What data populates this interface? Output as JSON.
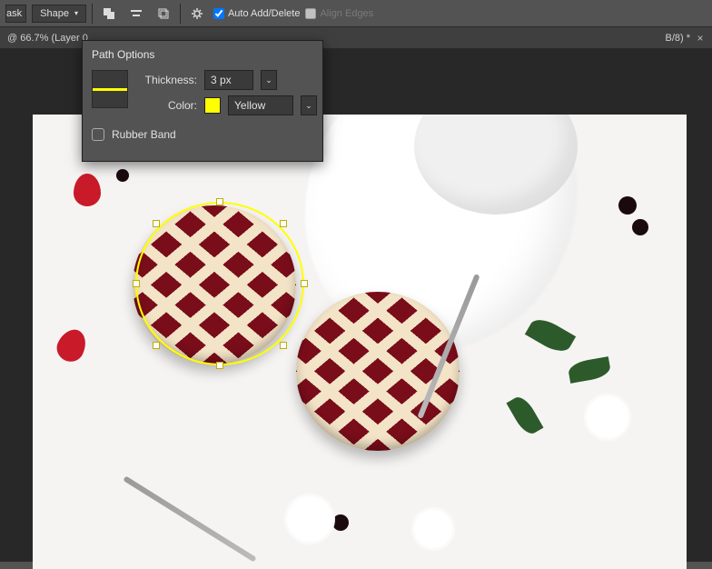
{
  "optionsBar": {
    "maskLabelFragment": "ask",
    "shapeLabel": "Shape",
    "autoAddDelete": {
      "label": "Auto Add/Delete",
      "checked": true
    },
    "alignEdges": {
      "label": "Align Edges",
      "checked": false
    }
  },
  "docTab": {
    "leftFragment": "@ 66.7% (Layer 0",
    "rightFragment": "B/8) *"
  },
  "pathOptions": {
    "title": "Path Options",
    "thicknessLabel": "Thickness:",
    "thicknessValue": "3 px",
    "colorLabel": "Color:",
    "colorName": "Yellow",
    "colorHex": "#ffff00",
    "rubberBandLabel": "Rubber Band",
    "rubberBandChecked": false
  }
}
